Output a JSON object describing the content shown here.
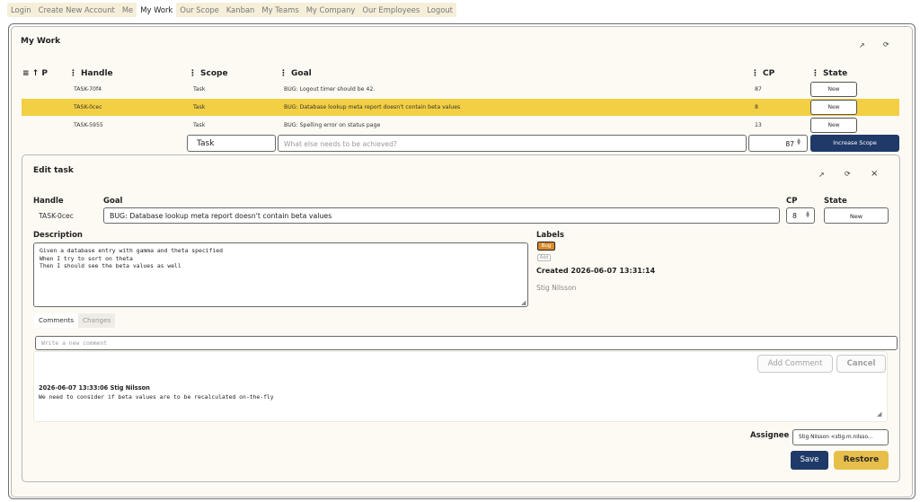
{
  "nav": {
    "items": [
      "Login",
      "Create New Account",
      "Me",
      "My Work",
      "Our Scope",
      "Kanban",
      "My Teams",
      "My Company",
      "Our Employees",
      "Logout"
    ],
    "active_index": 3
  },
  "my_work": {
    "title": "My Work",
    "headers": {
      "sort": "≡ ↑ P",
      "handle": "Handle",
      "scope": "Scope",
      "goal": "Goal",
      "cp": "CP",
      "state": "State"
    },
    "rows": [
      {
        "handle": "TASK-70f4",
        "scope": "Task",
        "goal": "BUG: Logout timer should be 42.",
        "cp": "87",
        "state": "New",
        "selected": false
      },
      {
        "handle": "TASK-0cec",
        "scope": "Task",
        "goal": "BUG: Database lookup meta report doesn't contain beta values",
        "cp": "8",
        "state": "New",
        "selected": true
      },
      {
        "handle": "TASK-5955",
        "scope": "Task",
        "goal": "BUG: Spelling error on status page",
        "cp": "13",
        "state": "New",
        "selected": false
      }
    ],
    "new_row": {
      "scope_value": "Task",
      "goal_placeholder": "What else needs to be achieved?",
      "cp_value": "87",
      "button": "Increase Scope"
    }
  },
  "edit_task": {
    "title": "Edit task",
    "labels": {
      "handle": "Handle",
      "goal": "Goal",
      "cp": "CP",
      "state": "State",
      "description": "Description",
      "labels": "Labels",
      "assignee": "Assignee"
    },
    "handle": "TASK-0cec",
    "goal": "BUG: Database lookup meta report doesn't contain beta values",
    "cp": "8",
    "state": "New",
    "description": "Given a database entry with gamma and theta specified\nWhen I try to sort on theta\nThen I should see the beta values as well",
    "label_tags": [
      "Bug"
    ],
    "label_add": "Add",
    "created": "Created 2026-06-07 13:31:14",
    "creator": "Stig Nilsson",
    "tabs": [
      "Comments",
      "Changes"
    ],
    "comment_placeholder": "Write a new comment",
    "add_comment_button": "Add Comment",
    "cancel_button": "Cancel",
    "comments": [
      {
        "header": "2026-06-07 13:33:06 Stig Nilsson",
        "body": "We need to consider if beta values are to be recalculated on-the-fly"
      }
    ],
    "assignee_value": "Stig Nilsson <stig.m.nilsso...",
    "save_button": "Save",
    "restore_button": "Restore"
  },
  "icons": {
    "expand": "↗",
    "refresh": "⟳",
    "close": "×",
    "drag": "⋮",
    "resize": "◢"
  },
  "colors": {
    "selected_row": "#f3cf43",
    "primary": "#1f3a68",
    "restore": "#e8be4a",
    "bug_tag": "#d98a2b",
    "panel_bg": "#fcfaf3"
  }
}
